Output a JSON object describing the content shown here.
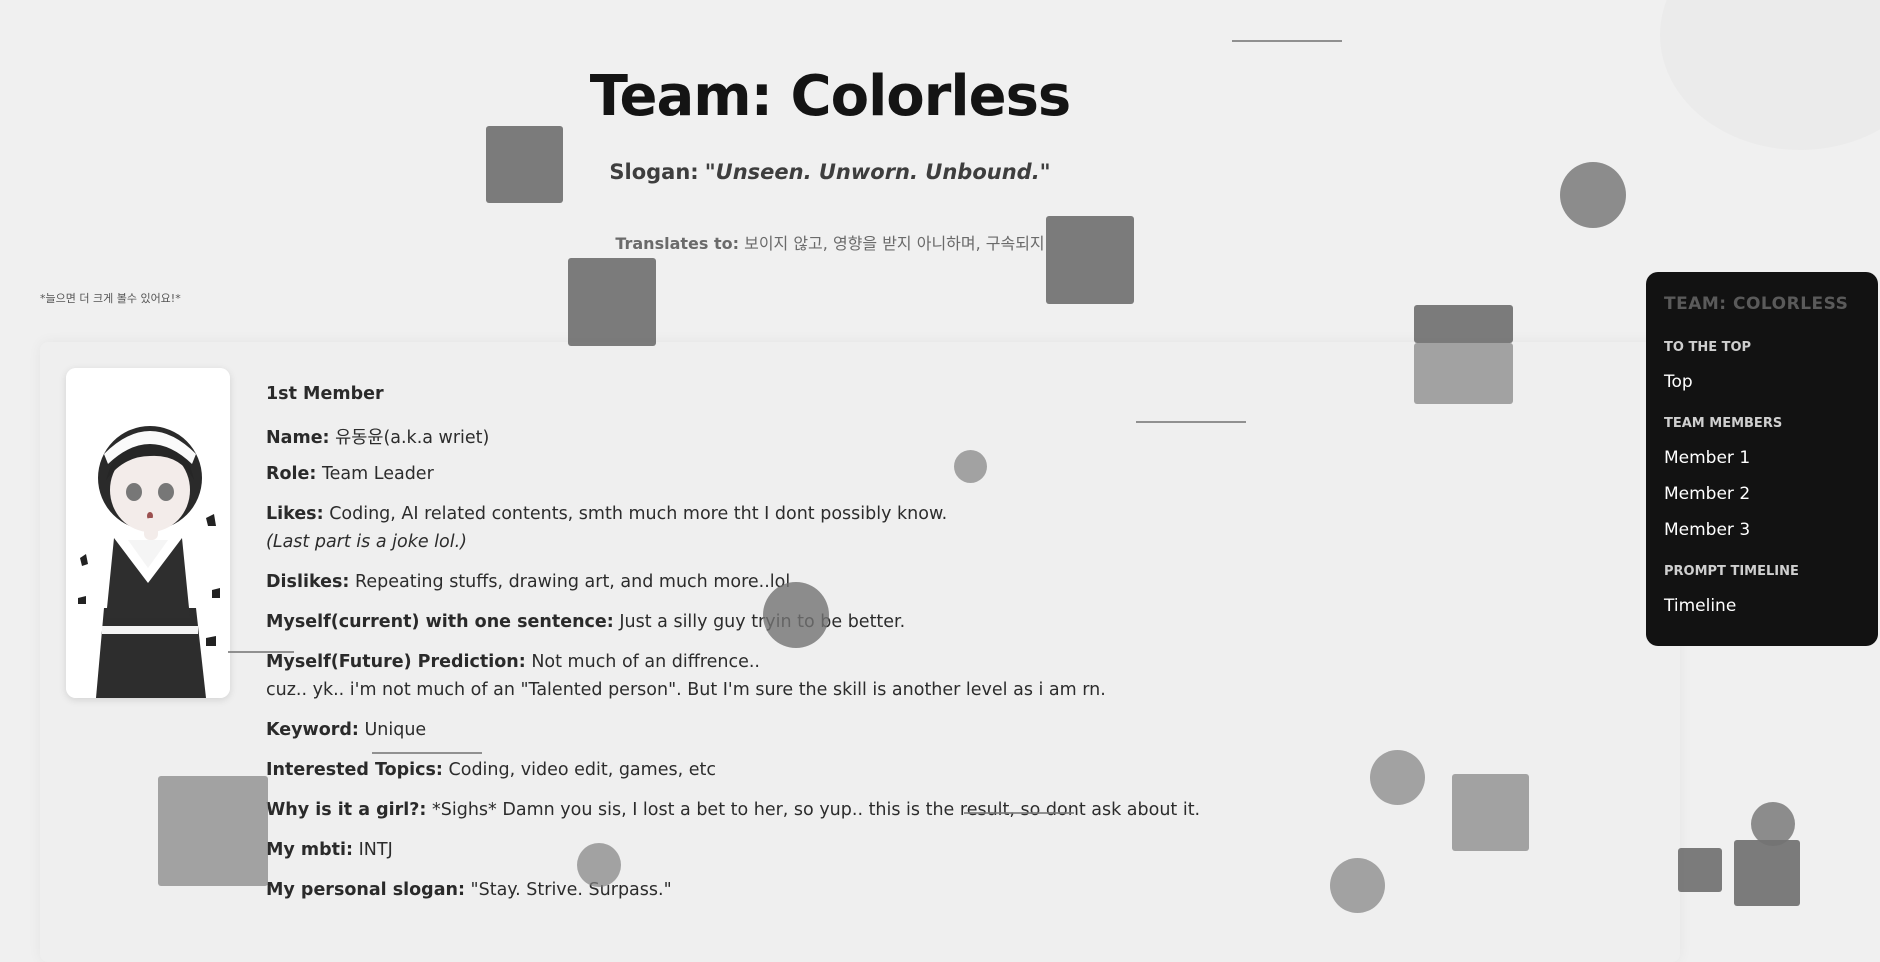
{
  "header": {
    "title": "Team: Colorless",
    "slogan_label": "Slogan:",
    "slogan_text": "\"Unseen. Unworn. Unbound.\"",
    "translates_label": "Translates to:",
    "translates_text": "보이지 않고, 영향을 받지 아니하며, 구속되지"
  },
  "zoom_note": "*늘으면 더 크게 볼수 있어요!*",
  "member": {
    "heading": "1st Member",
    "name_label": "Name:",
    "name_value": "유동윤(a.k.a wriet)",
    "role_label": "Role:",
    "role_value": "Team Leader",
    "likes_label": "Likes:",
    "likes_value": "Coding, AI related contents, smth much more tht I dont possibly know.",
    "likes_note": "(Last part is a joke lol.)",
    "dislikes_label": "Dislikes:",
    "dislikes_value": "Repeating stuffs, drawing art, and much more..lol",
    "current_label": "Myself(current) with one sentence:",
    "current_value": "Just a silly guy tryin to be better.",
    "future_label": "Myself(Future) Prediction:",
    "future_value": "Not much of an diffrence..",
    "future_line2": "cuz.. yk.. i'm not much of an \"Talented person\". But I'm sure the skill is another level as i am rn.",
    "keyword_label": "Keyword:",
    "keyword_value": "Unique",
    "topics_label": "Interested Topics:",
    "topics_value": "Coding, video edit, games, etc",
    "girl_label": "Why is it a girl?:",
    "girl_value": "*Sighs* Damn you sis, I lost a bet to her, so yup.. this is the result, so dont ask about it.",
    "mbti_label": "My mbti:",
    "mbti_value": "INTJ",
    "slogan_label": "My personal slogan:",
    "slogan_value": "\"Stay. Strive. Surpass.\""
  },
  "nav": {
    "title": "TEAM: COLORLESS",
    "section_top": "TO THE TOP",
    "link_top": "Top",
    "section_members": "TEAM MEMBERS",
    "link_member1": "Member 1",
    "link_member2": "Member 2",
    "link_member3": "Member 3",
    "section_timeline": "PROMPT TIMELINE",
    "link_timeline": "Timeline"
  },
  "colors": {
    "nav_bg": "#121212",
    "page_bg": "#f0f0f0",
    "shape_gray": "#6e6e6e"
  }
}
